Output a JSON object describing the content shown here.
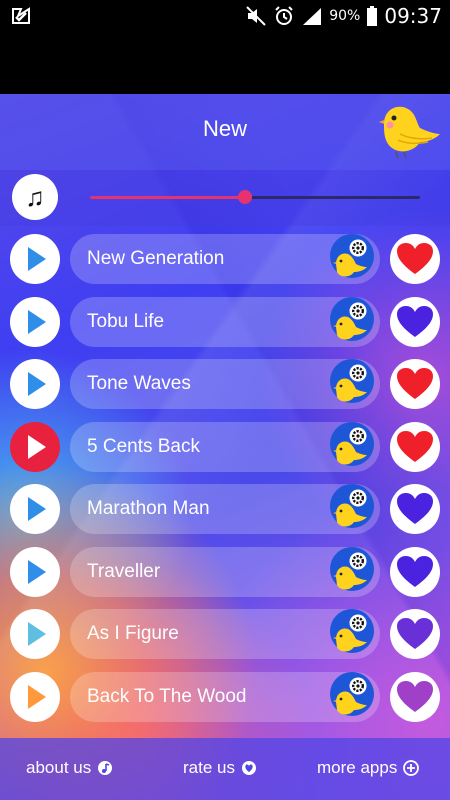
{
  "status_bar": {
    "battery_percent": "90%",
    "time": "09:37",
    "icons": [
      "app-check-icon",
      "mute-icon",
      "alarm-icon",
      "signal-icon",
      "battery-icon"
    ]
  },
  "header": {
    "title": "New",
    "logo_icon": "yellow-bird-icon"
  },
  "player": {
    "music_icon": "♫",
    "volume_level": 0.47
  },
  "songs": [
    {
      "title": "New Generation",
      "playing": false,
      "favorite": true,
      "play_color": "#2f8fe8"
    },
    {
      "title": "Tobu Life",
      "playing": false,
      "favorite": false,
      "play_color": "#2f8fe8"
    },
    {
      "title": "Tone Waves",
      "playing": false,
      "favorite": true,
      "play_color": "#2f8fe8"
    },
    {
      "title": "5 Cents Back",
      "playing": true,
      "favorite": true,
      "play_color": "#ffffff"
    },
    {
      "title": "Marathon Man",
      "playing": false,
      "favorite": false,
      "play_color": "#2f8fe8"
    },
    {
      "title": "Traveller",
      "playing": false,
      "favorite": false,
      "play_color": "#2f8fe8"
    },
    {
      "title": "As I Figure",
      "playing": false,
      "favorite": false,
      "play_color": "#5fbfe0"
    },
    {
      "title": "Back To The Wood",
      "playing": false,
      "favorite": false,
      "play_color": "#ff9a3c"
    }
  ],
  "heart_colors": {
    "favorite": "#f0202a",
    "not_favorite": [
      "#4a22e0",
      "#4a22e0",
      "#4a22e0",
      "#6a30d8",
      "#a040c8",
      "#c050c0"
    ]
  },
  "bottom_nav": {
    "about": "about us",
    "rate": "rate us",
    "more": "more apps"
  }
}
